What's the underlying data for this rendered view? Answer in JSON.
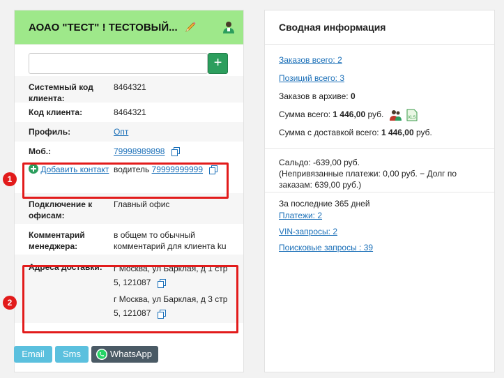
{
  "client": {
    "title": "АОАО \"ТЕСТ\" ! ТЕСТОВЫЙ...",
    "search_placeholder": "",
    "add_label": "+",
    "rows": {
      "system_code_label": "Системный код клиента:",
      "system_code_value": "8464321",
      "client_code_label": "Код клиента:",
      "client_code_value": "8464321",
      "profile_label": "Профиль:",
      "profile_value": "Опт",
      "mobile_label": "Моб.:",
      "mobile_value": "79998989898",
      "add_contact_label": "Добавить контакт",
      "driver_prefix": "водитель",
      "driver_phone": "79999999999",
      "offices_label": "Подключение к офисам:",
      "offices_value": "Главный офис",
      "comment_label": "Комментарий менеджера:",
      "comment_value": "в общем то обычный комментарий для клиента ku",
      "addresses_label": "Адреса доставки:",
      "address_1": "г Москва, ул Барклая, д 1 стр 5, 121087",
      "address_2": "г Москва, ул Барклая, д 3 стр 5, 121087"
    },
    "badges": {
      "one": "1",
      "two": "2"
    },
    "buttons": {
      "email": "Email",
      "sms": "Sms",
      "whatsapp": "WhatsApp"
    }
  },
  "summary": {
    "title": "Сводная информация",
    "orders_total": "Заказов всего: 2",
    "positions_total": "Позиций всего: 3",
    "archive_label": "Заказов в архиве:",
    "archive_value": "0",
    "sum_label": "Сумма всего:",
    "sum_value": "1 446,00",
    "sum_currency": "руб.",
    "delivery_sum_label": "Сумма с доставкой всего:",
    "delivery_sum_value": "1 446,00",
    "delivery_sum_currency": "руб.",
    "saldo_line1": "Сальдо: -639,00 руб.",
    "saldo_line2": "(Непривязанные платежи: 0,00 руб. − Долг по",
    "saldo_line3": "заказам: 639,00 руб.)",
    "period": "За последние 365 дней",
    "payments": "Платежи: 2",
    "vin_requests": "VIN-запросы: 2",
    "search_requests": "Поисковые запросы : 39"
  },
  "colors": {
    "header_green": "#9ee88a",
    "add_button": "#2c9e5d",
    "highlight_red": "#e21b1b",
    "link_blue": "#1a6fb8",
    "sms_email_blue": "#5bc0de",
    "whatsapp_dark": "#4a5a65"
  },
  "icons": [
    "pencil-icon",
    "user-icon",
    "copy-icon",
    "plus-circle-icon",
    "whatsapp-icon",
    "xls-icon",
    "people-icon"
  ]
}
